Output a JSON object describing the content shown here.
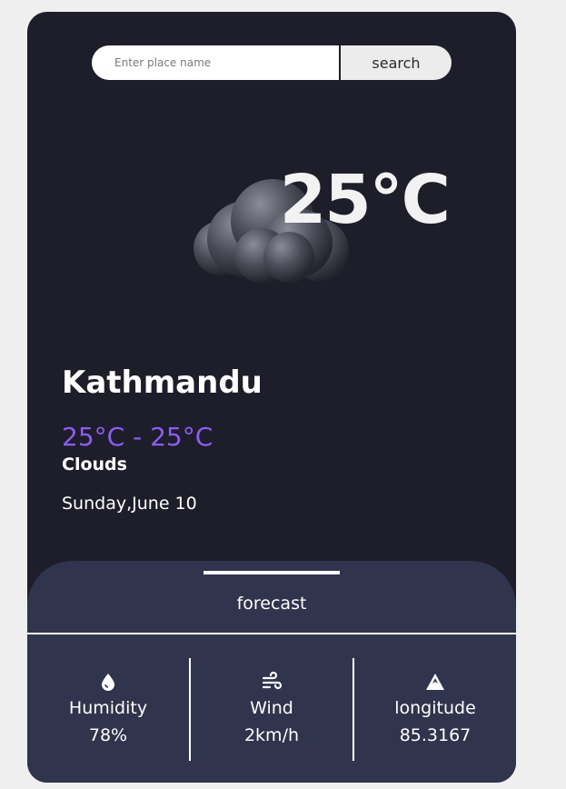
{
  "search": {
    "placeholder": "Enter place name",
    "button_label": "search"
  },
  "weather": {
    "temperature": "25°C",
    "city": "Kathmandu",
    "range": "25°C - 25°C",
    "condition": "Clouds",
    "date": "Sunday,June 10",
    "icon": "cloud-icon"
  },
  "panel": {
    "tab_label": "forecast",
    "stats": [
      {
        "icon": "humidity-drop-icon",
        "label": "Humidity",
        "value": "78%"
      },
      {
        "icon": "wind-icon",
        "label": "Wind",
        "value": "2km/h"
      },
      {
        "icon": "mountain-icon",
        "label": "longitude",
        "value": "85.3167"
      }
    ]
  },
  "colors": {
    "page_bg": "#efefef",
    "card_bg": "#1d1e29",
    "panel_bg": "#30344d",
    "accent_purple": "#8d5cf6",
    "text": "#ffffff"
  }
}
